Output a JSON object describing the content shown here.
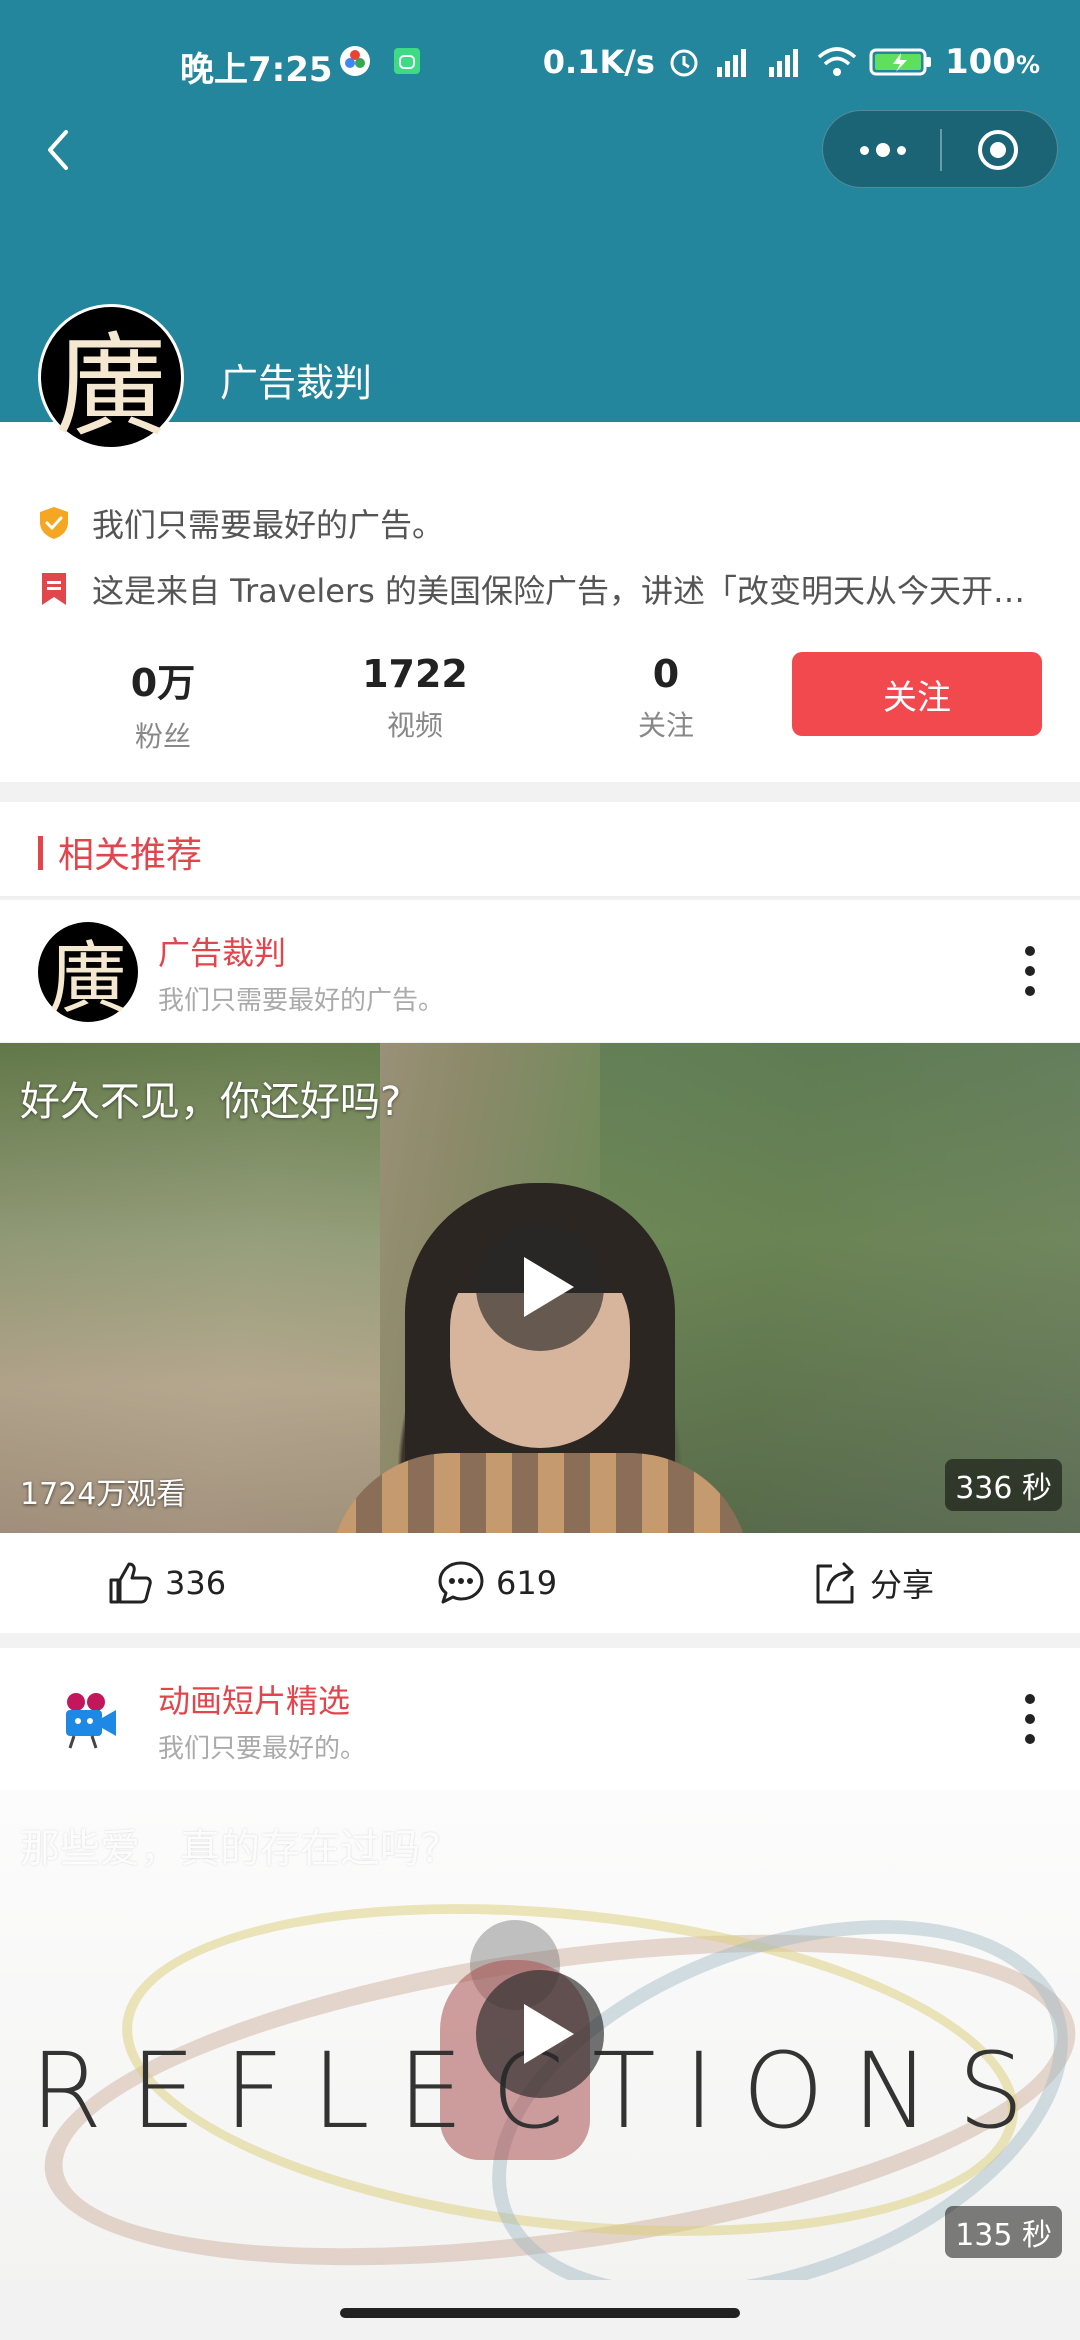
{
  "status_bar": {
    "time": "晚上7:25",
    "net_speed": "0.1K/s",
    "battery": "100",
    "battery_unit": "%"
  },
  "nav": {
    "back_icon": "chevron-left-icon",
    "more_icon": "more-dots-icon",
    "close_icon": "target-circle-icon"
  },
  "profile": {
    "avatar_char": "廣",
    "name": "广告裁判",
    "slogan": "我们只需要最好的广告。",
    "intro": "这是来自 Travelers 的美国保险广告，讲述「改变明天从今天开始」",
    "stats": [
      {
        "value": "0万",
        "label": "粉丝"
      },
      {
        "value": "1722",
        "label": "视频"
      },
      {
        "value": "0",
        "label": "关注"
      }
    ],
    "follow_label": "关注"
  },
  "section": {
    "title": "相关推荐"
  },
  "posts": [
    {
      "avatar_char": "廣",
      "author": "广告裁判",
      "desc": "我们只需要最好的广告。",
      "video_title": "好久不见，你还好吗?",
      "views": "1724万观看",
      "duration": "336 秒",
      "likes": "336",
      "comments": "619",
      "share_label": "分享"
    },
    {
      "author": "动画短片精选",
      "desc": "我们只要最好的。",
      "video_title": "那些爱，真的存在过吗?",
      "poster_text": "REFLECTIONS",
      "duration": "135 秒"
    }
  ],
  "colors": {
    "header_bg": "#24869c",
    "accent_red": "#e2464d",
    "follow_bg": "#f2494f"
  }
}
